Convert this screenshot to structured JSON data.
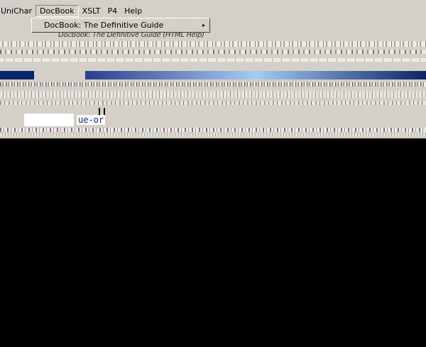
{
  "menubar": {
    "items": [
      "UniChar",
      "DocBook",
      "XSLT",
      "P4",
      "Help"
    ],
    "open_item": "DocBook"
  },
  "dropdown": {
    "items": [
      {
        "label": "DocBook: The Definitive Guide",
        "submenu_arrow": "▸"
      },
      {
        "label": "DocBook: The Definitive Guide (HTML Help)"
      }
    ]
  },
  "document": {
    "code_fragment": "ue-or"
  }
}
